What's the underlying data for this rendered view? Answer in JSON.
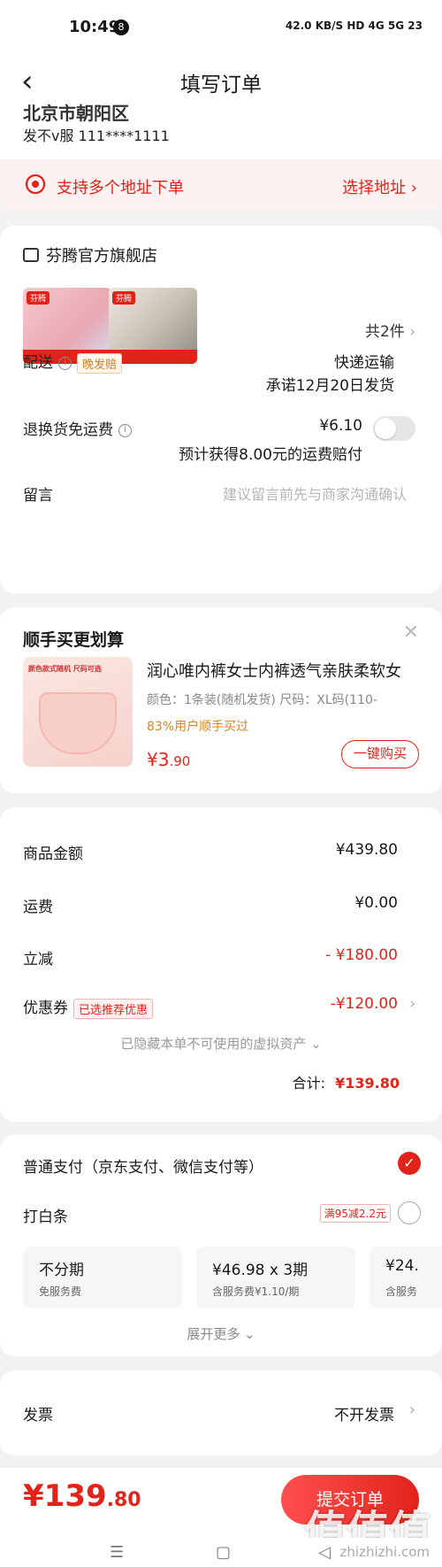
{
  "status_bar": {
    "time": "10:49",
    "badge": "8",
    "right_text": "42.0 KB/S  HD  4G  5G  23"
  },
  "nav": {
    "title": "填写订单"
  },
  "address": {
    "partial_text": "北京市朝阳区",
    "person": "发不v服  111****1111"
  },
  "multi_address": {
    "label": "支持多个地址下单",
    "action": "选择地址 ›"
  },
  "shop": {
    "name": "芬腾官方旗舰店",
    "item_count": "共2件",
    "product_logo": "芬腾"
  },
  "delivery": {
    "label": "配送",
    "tag": "晚发赔",
    "method": "快递运输",
    "promise": "承诺12月20日发货"
  },
  "return_shipping": {
    "label": "退换货免运费",
    "price": "¥6.10",
    "note": "预计获得8.00元的运费赔付"
  },
  "message": {
    "label": "留言",
    "placeholder": "建议留言前先与商家沟通确认"
  },
  "recommend": {
    "title": "顺手买更划算",
    "close": "✕",
    "image_caption": "颜色款式随机 尺码可选",
    "name": "润心唯内裤女士内裤透气亲肤柔软女",
    "spec": "颜色：1条装(随机发货)   尺码：XL码(110-",
    "hint": "83%用户顺手买过",
    "price_main": "¥3",
    "price_dec": ".90",
    "button": "一键购买"
  },
  "amounts": {
    "goods_label": "商品金额",
    "goods_value": "¥439.80",
    "freight_label": "运费",
    "freight_value": "¥0.00",
    "discount_label": "立减",
    "discount_value": "- ¥180.00",
    "coupon_label": "优惠券",
    "coupon_tag": "已选推荐优惠",
    "coupon_value": "-¥120.00",
    "hidden_note": "已隐藏本单不可使用的虚拟资产 ⌄",
    "total_label": "合计:",
    "total_value": "¥139.80"
  },
  "payment": {
    "normal_label": "普通支付（京东支付、微信支付等）",
    "baitiao_label": "打白条",
    "baitiao_promo": "满95减2.2元",
    "installments": [
      {
        "title": "不分期",
        "sub": "免服务费"
      },
      {
        "title": "¥46.98 x 3期",
        "sub": "含服务费¥1.10/期"
      },
      {
        "title": "¥24.",
        "sub": "含服务"
      }
    ],
    "expand": "展开更多 ⌄"
  },
  "invoice": {
    "label": "发票",
    "value": "不开发票"
  },
  "bottom": {
    "total_main": "¥139",
    "total_dec": ".80",
    "submit": "提交订单"
  },
  "watermark": {
    "mark": "值值值",
    "site": "zhizhizhi.com"
  },
  "colors": {
    "accent": "#e2231a",
    "tag_orange": "#d4852a"
  }
}
